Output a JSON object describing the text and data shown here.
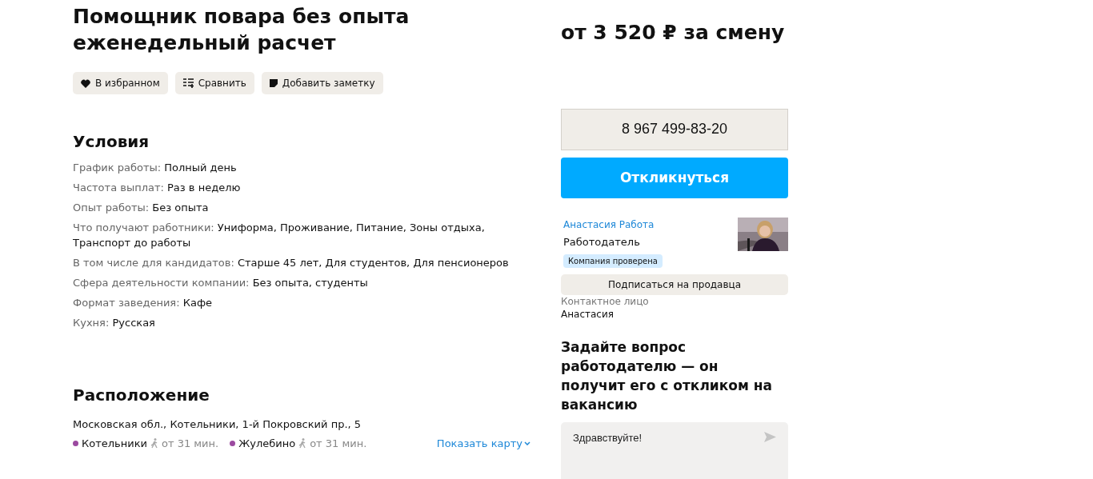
{
  "title": "Помощник повара без опыта еженедельный расчет",
  "actions": [
    {
      "kind": "favorite",
      "label": "В избранном"
    },
    {
      "kind": "compare",
      "label": "Сравнить"
    },
    {
      "kind": "note",
      "label": "Добавить заметку"
    }
  ],
  "conditions": {
    "heading": "Условия",
    "items": [
      {
        "label": "График работы:",
        "value": "Полный день"
      },
      {
        "label": "Частота выплат:",
        "value": "Раз в неделю"
      },
      {
        "label": "Опыт работы:",
        "value": "Без опыта"
      },
      {
        "label": "Что получают работники:",
        "value": "Униформа, Проживание, Питание, Зоны отдыха, Транспорт до работы"
      },
      {
        "label": "В том числе для кандидатов:",
        "value": "Старше 45 лет, Для студентов, Для пенсионеров"
      },
      {
        "label": "Сфера деятельности компании:",
        "value": "Без опыта, студенты"
      },
      {
        "label": "Формат заведения:",
        "value": "Кафе"
      },
      {
        "label": "Кухня:",
        "value": "Русская"
      }
    ]
  },
  "location": {
    "heading": "Расположение",
    "address": "Московская обл., Котельники, 1-й Покровский пр., 5",
    "stations": [
      {
        "name": "Котельники",
        "color": "#9b4aa0",
        "time": "от 31 мин."
      },
      {
        "name": "Жулебино",
        "color": "#9b4aa0",
        "time": "от 31 мин."
      }
    ],
    "map_link": "Показать карту"
  },
  "salary": "от 3 520 ₽ за смену",
  "phone": "8 967 499-83-20",
  "respond_button": "Откликнуться",
  "seller": {
    "name": "Анастасия Работа",
    "role": "Работодатель",
    "badge": "Компания проверена",
    "subscribe": "Подписаться на продавца",
    "contact_label": "Контактное лицо",
    "contact_name": "Анастасия"
  },
  "question": {
    "heading": "Задайте вопрос работодателю — он получит его с откликом на вакансию",
    "message": "Здравствуйте!"
  }
}
